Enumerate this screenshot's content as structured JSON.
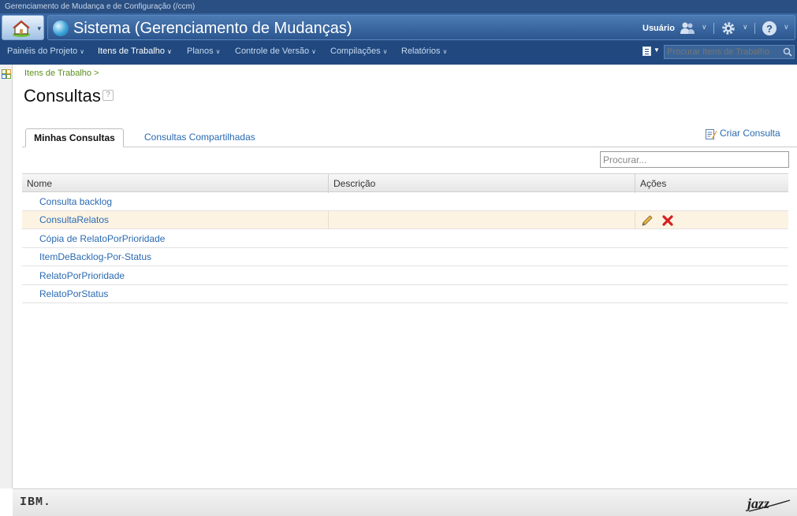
{
  "app": {
    "window_title": "Gerenciamento de Mudança e de Configuração (/ccm)",
    "header_title": "Sistema (Gerenciamento de Mudanças)",
    "user_label": "Usuário"
  },
  "nav": {
    "items": [
      {
        "label": "Painéis do Projeto"
      },
      {
        "label": "Itens de Trabalho"
      },
      {
        "label": "Planos"
      },
      {
        "label": "Controle de Versão"
      },
      {
        "label": "Compilações"
      },
      {
        "label": "Relatórios"
      }
    ],
    "search_placeholder": "Procurar Itens de Trabalho"
  },
  "page": {
    "breadcrumb": "Itens de Trabalho >",
    "title": "Consultas",
    "help_icon": "?"
  },
  "tabs": [
    {
      "label": "Minhas Consultas",
      "selected": true
    },
    {
      "label": "Consultas Compartilhadas",
      "selected": false
    }
  ],
  "create_query_label": "Criar Consulta",
  "filter_placeholder": "Procurar...",
  "table": {
    "columns": [
      "Nome",
      "Descrição",
      "Ações"
    ],
    "rows": [
      {
        "name": "Consulta backlog",
        "description": ""
      },
      {
        "name": "ConsultaRelatos",
        "description": ""
      },
      {
        "name": "Cópia de RelatoPorPrioridade",
        "description": ""
      },
      {
        "name": "ItemDeBacklog-Por-Status",
        "description": ""
      },
      {
        "name": "RelatoPorPrioridade",
        "description": ""
      },
      {
        "name": "RelatoPorStatus",
        "description": ""
      }
    ],
    "hover_row_actions": [
      "edit-icon",
      "delete-icon"
    ]
  },
  "footer": {
    "left_logo": "IBM.",
    "right_logo": "jazz"
  },
  "colors": {
    "header_blue": "#21497f",
    "link_blue": "#2a6ab2",
    "breadcrumb_green": "#5c8f1e",
    "row_highlight": "#fdf3e3",
    "delete_red": "#d42020"
  }
}
